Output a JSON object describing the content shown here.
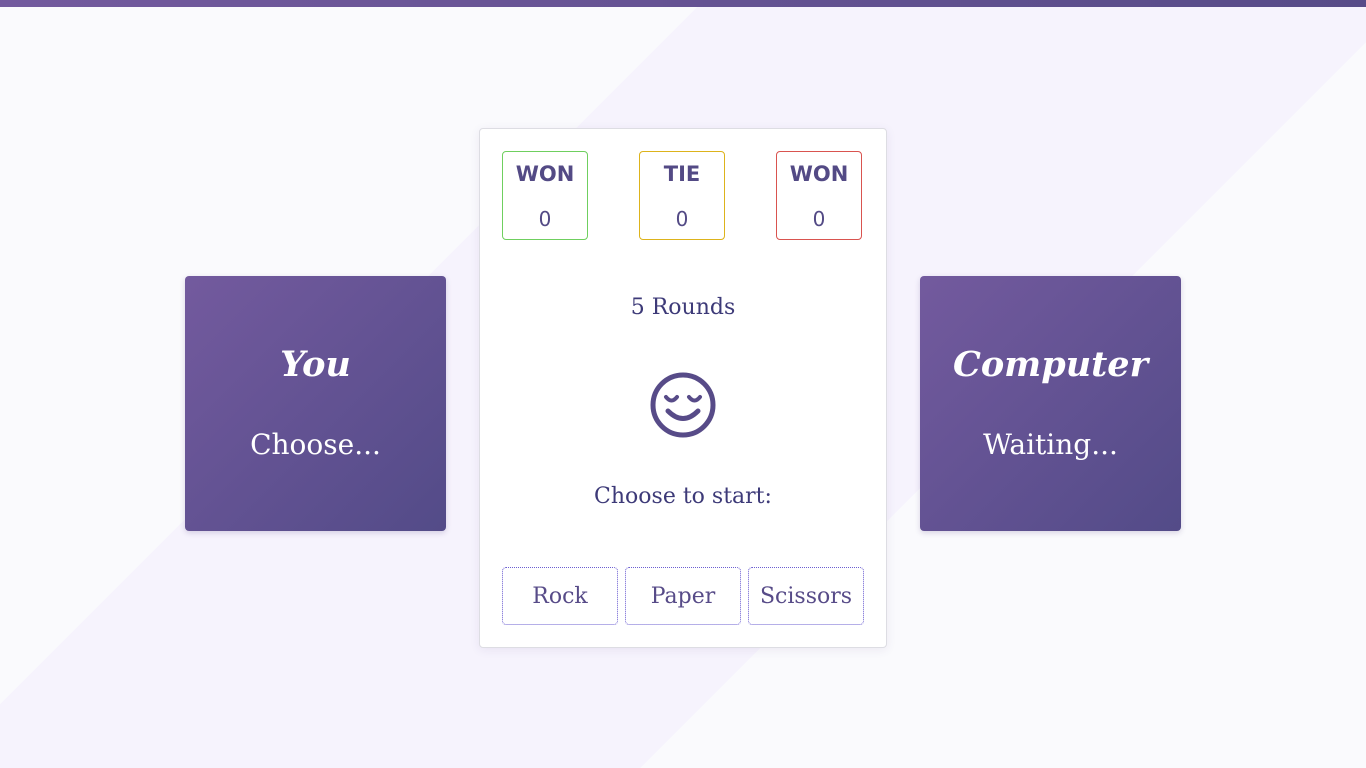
{
  "colors": {
    "accent": "#574b88",
    "panel_gradient_start": "#735a9e",
    "panel_gradient_end": "#534b88",
    "won_border": "#6fcf5f",
    "tie_border": "#ddb31b",
    "lost_border": "#d9534f"
  },
  "player": {
    "name": "You",
    "status": "Choose..."
  },
  "computer": {
    "name": "Computer",
    "status": "Waiting..."
  },
  "scoreboard": {
    "won": {
      "label": "WON",
      "value": "0"
    },
    "tie": {
      "label": "TIE",
      "value": "0"
    },
    "lost": {
      "label": "WON",
      "value": "0"
    }
  },
  "rounds_label": "5 Rounds",
  "status_icon": "relieved-face-icon",
  "prompt": "Choose to start:",
  "choices": {
    "rock": "Rock",
    "paper": "Paper",
    "scissors": "Scissors"
  }
}
